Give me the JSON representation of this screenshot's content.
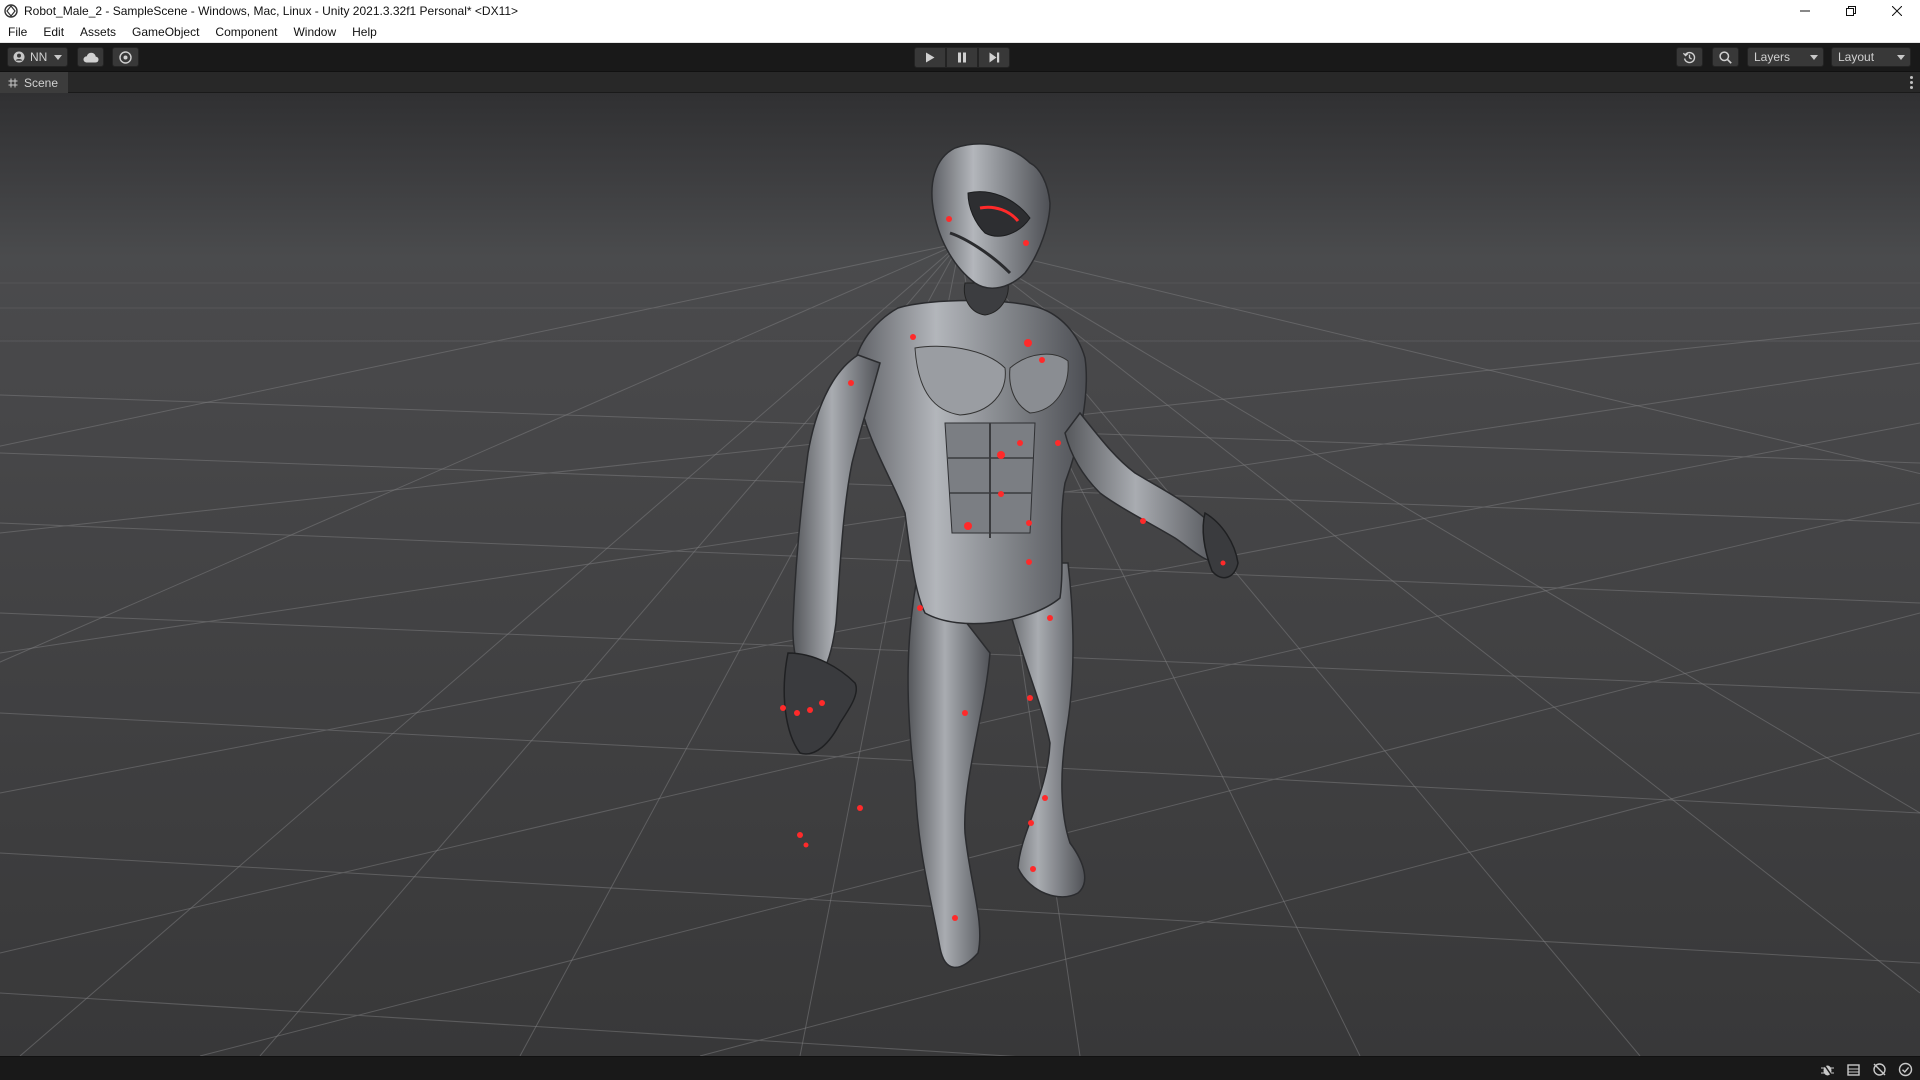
{
  "window": {
    "title": "Robot_Male_2 - SampleScene - Windows, Mac, Linux - Unity 2021.3.32f1 Personal* <DX11>",
    "controls": [
      "minimize",
      "restore",
      "close"
    ]
  },
  "menu": {
    "items": [
      "File",
      "Edit",
      "Assets",
      "GameObject",
      "Component",
      "Window",
      "Help"
    ]
  },
  "toolbar": {
    "account_label": "NN",
    "cloud_icon": "cloud-icon",
    "collab_icon": "collab-icon",
    "play_icon": "play-icon",
    "pause_icon": "pause-icon",
    "step_icon": "step-icon",
    "history_icon": "history-icon",
    "search_icon": "search-icon",
    "layers_label": "Layers",
    "layout_label": "Layout"
  },
  "scene": {
    "tab_label": "Scene",
    "tab_icon": "hash-icon",
    "subject": "robot-character-model"
  },
  "statusbar": {
    "icons": [
      "debug-icon",
      "package-icon",
      "network-icon",
      "check-icon"
    ]
  },
  "colors": {
    "title_bg": "#ffffff",
    "toolbar_bg": "#191919",
    "viewport_bg_top": "#2f2f31",
    "viewport_bg_bottom": "#3b3b3d",
    "grid": "#7a7a7a",
    "robot_body": "#8e9196",
    "robot_accent": "#ff2a2a"
  }
}
